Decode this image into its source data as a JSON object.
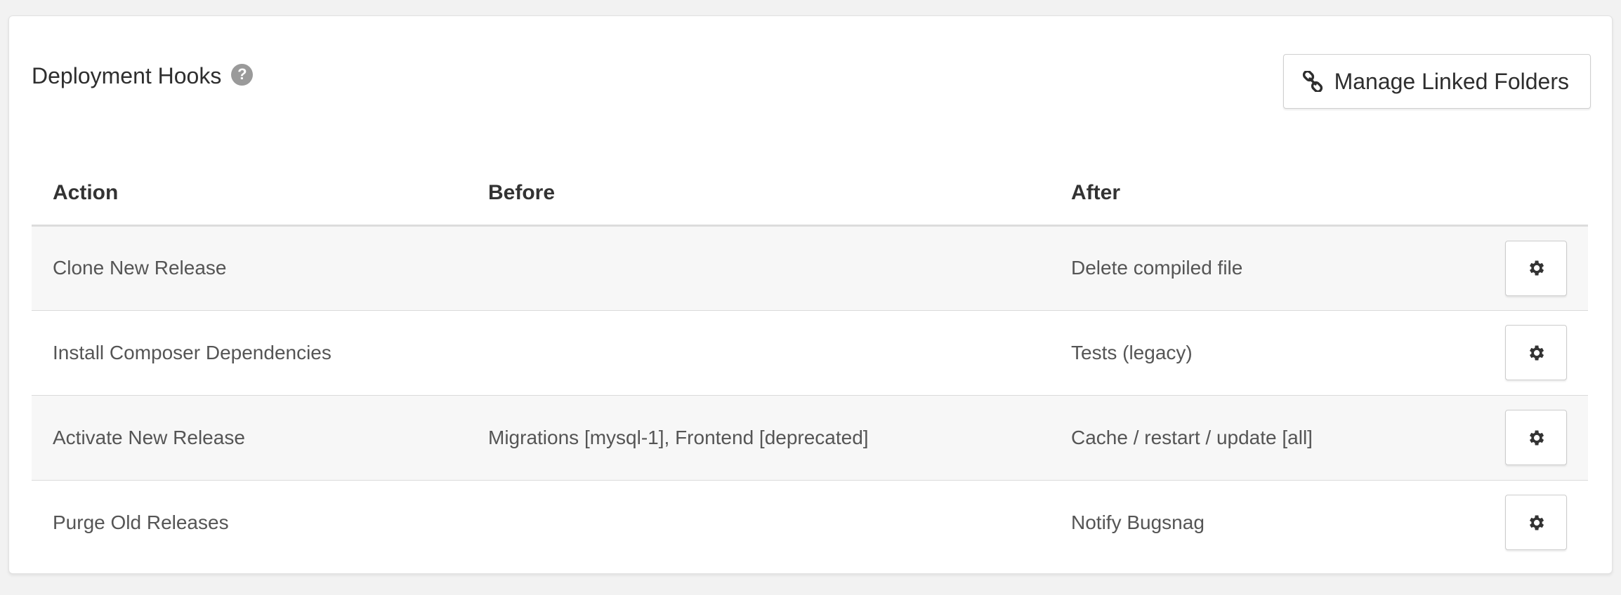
{
  "panel": {
    "title": "Deployment Hooks",
    "help_icon": "question-circle-icon",
    "linked_folders_button": {
      "label": "Manage Linked Folders",
      "icon": "link-icon"
    }
  },
  "table": {
    "headers": {
      "action": "Action",
      "before": "Before",
      "after": "After"
    },
    "rows": [
      {
        "action": "Clone New Release",
        "before": "",
        "after": "Delete compiled file",
        "config_icon": "gear-icon"
      },
      {
        "action": "Install Composer Dependencies",
        "before": "",
        "after": "Tests (legacy)",
        "config_icon": "gear-icon"
      },
      {
        "action": "Activate New Release",
        "before": "Migrations [mysql-1], Frontend [deprecated]",
        "after": "Cache / restart / update [all]",
        "config_icon": "gear-icon"
      },
      {
        "action": "Purge Old Releases",
        "before": "",
        "after": "Notify Bugsnag",
        "config_icon": "gear-icon"
      }
    ]
  }
}
